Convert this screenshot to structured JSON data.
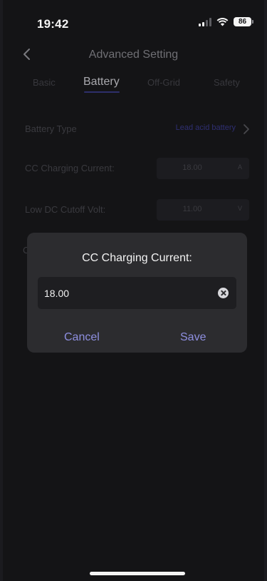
{
  "status_bar": {
    "time": "19:42",
    "battery_level": "86"
  },
  "nav": {
    "title": "Advanced Setting",
    "back_icon": "chevron-left-icon"
  },
  "tabs": [
    {
      "label": "Basic"
    },
    {
      "label": "Battery",
      "active": true
    },
    {
      "label": "Off-Grid"
    },
    {
      "label": "Safety"
    }
  ],
  "settings": {
    "battery_type": {
      "label": "Battery Type",
      "value": "Lead acid battery"
    },
    "cc_charging_current": {
      "label": "CC Charging Current:",
      "value": "18.00",
      "unit": "A"
    },
    "low_dc_cutoff": {
      "label": "Low DC Cutoff Volt:",
      "value": "11.00",
      "unit": "V"
    },
    "hidden_row_fragment": "C"
  },
  "dialog": {
    "title": "CC Charging Current:",
    "input_value": "18.00",
    "cancel_label": "Cancel",
    "save_label": "Save"
  },
  "colors": {
    "background": "#141416",
    "dialog": "#2c2c2f",
    "accent": "#8e8fe0",
    "dim_accent": "#2f2f72"
  }
}
